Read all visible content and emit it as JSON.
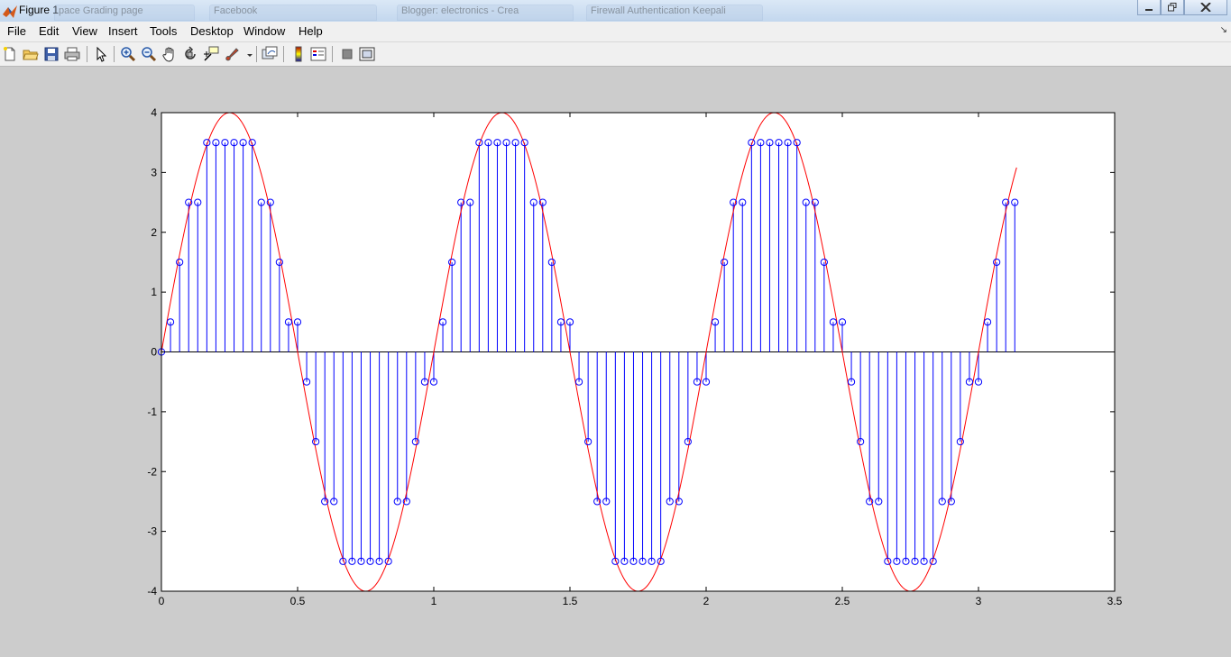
{
  "window": {
    "title": "Figure 1",
    "background_tabs": [
      {
        "label": "pace Grading page"
      },
      {
        "label": "Facebook"
      },
      {
        "label": "Blogger: electronics - Crea"
      },
      {
        "label": "Firewall Authentication Keepali"
      }
    ]
  },
  "menubar": {
    "items": [
      {
        "label": "File"
      },
      {
        "label": "Edit"
      },
      {
        "label": "View"
      },
      {
        "label": "Insert"
      },
      {
        "label": "Tools"
      },
      {
        "label": "Desktop"
      },
      {
        "label": "Window"
      },
      {
        "label": "Help"
      }
    ]
  },
  "toolbar": {
    "buttons": [
      {
        "icon": "new-figure-icon"
      },
      {
        "icon": "open-file-icon"
      },
      {
        "icon": "save-icon"
      },
      {
        "icon": "print-icon"
      },
      {
        "icon": "edit-plot-arrow-icon"
      },
      {
        "icon": "zoom-in-icon"
      },
      {
        "icon": "zoom-out-icon"
      },
      {
        "icon": "pan-hand-icon"
      },
      {
        "icon": "rotate-3d-icon"
      },
      {
        "icon": "data-cursor-icon"
      },
      {
        "icon": "brush-icon"
      },
      {
        "icon": "link-plot-icon"
      },
      {
        "icon": "insert-colorbar-icon"
      },
      {
        "icon": "insert-legend-icon"
      },
      {
        "icon": "hide-plot-tools-icon"
      },
      {
        "icon": "show-plot-tools-icon"
      }
    ]
  },
  "colors": {
    "stem": "#0000ff",
    "sine": "#ff0000",
    "axes_bg": "#ffffff",
    "figure_bg": "#cccccc"
  },
  "chart_data": {
    "type": "line",
    "title": "",
    "xlabel": "",
    "ylabel": "",
    "xlim": [
      0,
      3.5
    ],
    "ylim": [
      -4,
      4
    ],
    "xticks": [
      "0",
      "0.5",
      "1",
      "1.5",
      "2",
      "2.5",
      "3",
      "3.5"
    ],
    "yticks": [
      "-4",
      "-3",
      "-2",
      "-1",
      "0",
      "1",
      "2",
      "3",
      "4"
    ],
    "grid": false,
    "series": [
      {
        "style": "stem",
        "marker": "circle",
        "x": [
          0,
          0.0333,
          0.0667,
          0.1,
          0.1333,
          0.1667,
          0.2,
          0.2333,
          0.2667,
          0.3,
          0.3333,
          0.3667,
          0.4,
          0.4333,
          0.4667,
          0.5,
          0.5333,
          0.5667,
          0.6,
          0.6333,
          0.6667,
          0.7,
          0.7333,
          0.7667,
          0.8,
          0.8333,
          0.8667,
          0.9,
          0.9333,
          0.9667,
          1.0,
          1.0333,
          1.0667,
          1.1,
          1.1333,
          1.1667,
          1.2,
          1.2333,
          1.2667,
          1.3,
          1.3333,
          1.3667,
          1.4,
          1.4333,
          1.4667,
          1.5,
          1.5333,
          1.5667,
          1.6,
          1.6333,
          1.6667,
          1.7,
          1.7333,
          1.7667,
          1.8,
          1.8333,
          1.8667,
          1.9,
          1.9333,
          1.9667,
          2.0,
          2.0333,
          2.0667,
          2.1,
          2.1333,
          2.1667,
          2.2,
          2.2333,
          2.2667,
          2.3,
          2.3333,
          2.3667,
          2.4,
          2.4333,
          2.4667,
          2.5,
          2.5333,
          2.5667,
          2.6,
          2.6333,
          2.6667,
          2.7,
          2.7333,
          2.7667,
          2.8,
          2.8333,
          2.8667,
          2.9,
          2.9333,
          2.9667,
          3.0,
          3.0333,
          3.0667,
          3.1,
          3.1333
        ],
        "y": [
          0,
          0.5,
          1.5,
          2.5,
          2.5,
          3.5,
          3.5,
          3.5,
          3.5,
          3.5,
          3.5,
          2.5,
          2.5,
          1.5,
          0.5,
          0.5,
          -0.5,
          -1.5,
          -2.5,
          -2.5,
          -3.5,
          -3.5,
          -3.5,
          -3.5,
          -3.5,
          -3.5,
          -2.5,
          -2.5,
          -1.5,
          -0.5,
          -0.5,
          0.5,
          1.5,
          2.5,
          2.5,
          3.5,
          3.5,
          3.5,
          3.5,
          3.5,
          3.5,
          2.5,
          2.5,
          1.5,
          0.5,
          0.5,
          -0.5,
          -1.5,
          -2.5,
          -2.5,
          -3.5,
          -3.5,
          -3.5,
          -3.5,
          -3.5,
          -3.5,
          -2.5,
          -2.5,
          -1.5,
          -0.5,
          -0.5,
          0.5,
          1.5,
          2.5,
          2.5,
          3.5,
          3.5,
          3.5,
          3.5,
          3.5,
          3.5,
          2.5,
          2.5,
          1.5,
          0.5,
          0.5,
          -0.5,
          -1.5,
          -2.5,
          -2.5,
          -3.5,
          -3.5,
          -3.5,
          -3.5,
          -3.5,
          -3.5,
          -2.5,
          -2.5,
          -1.5,
          -0.5,
          -0.5,
          0.5,
          1.5,
          2.5,
          2.5
        ]
      },
      {
        "style": "line",
        "function": "4*sin(2*pi*x)",
        "amplitude": 4,
        "frequency_hz": 1,
        "x_range": [
          0,
          3.14
        ]
      }
    ]
  }
}
